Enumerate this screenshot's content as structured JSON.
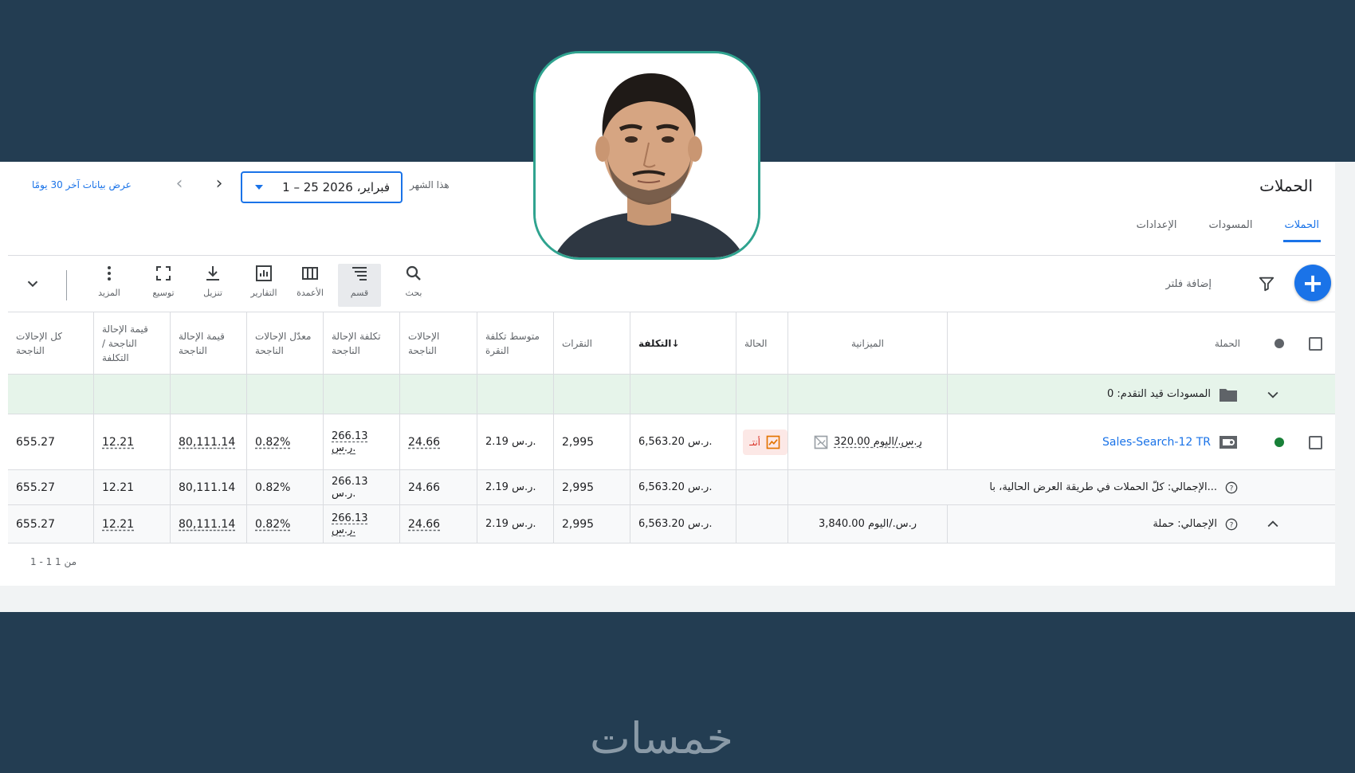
{
  "header": {
    "page_title": "الحملات",
    "date_range_link": "عرض بيانات آخر 30 يومًا",
    "date_range": "1 – 25 فبراير، 2026",
    "date_preset": "هذا الشهر"
  },
  "tabs": [
    {
      "label": "الحملات",
      "active": true
    },
    {
      "label": "المسودات",
      "active": false
    },
    {
      "label": "الإعدادات",
      "active": false
    }
  ],
  "toolbar": {
    "add_filter": "إضافة فلتر",
    "tools": [
      {
        "label": "بحث",
        "icon": "search-icon"
      },
      {
        "label": "قسم",
        "icon": "segment-icon"
      },
      {
        "label": "الأعمدة",
        "icon": "columns-icon"
      },
      {
        "label": "التقارير",
        "icon": "reports-icon"
      },
      {
        "label": "تنزيل",
        "icon": "download-icon"
      },
      {
        "label": "توسيع",
        "icon": "expand-icon"
      },
      {
        "label": "المزيد",
        "icon": "more-icon"
      }
    ]
  },
  "table": {
    "headers": {
      "campaign": "الحملة",
      "budget": "الميزانية",
      "status": "الحالة",
      "cost": "التكلفة",
      "clicks": "النقرات",
      "avg_cpc": "متوسط تكلفة النقرة",
      "conversions": "الإحالات الناجحة",
      "cost_per_conv": "تكلفة الإحالة الناجحة",
      "conv_rate": "معدّل الإحالات الناجحة",
      "conv_value": "قيمة الإحالة الناجحة",
      "value_per_cost": "قيمة الإحالة الناجحة / التكلفة",
      "all_conv": "كل الإحالات الناجحة"
    },
    "drafts_row": "المسودات قيد التقدم: 0",
    "campaign_row": {
      "name": "Sales-Search-12 TR",
      "budget": "320.00 ر.س./اليوم",
      "status": "أنتـ",
      "cost": "6,563.20 ر.س.",
      "clicks": "2,995",
      "avg_cpc": "2.19 ر.س.",
      "conversions": "24.66",
      "cost_per_conv": "266.13 ر.س.",
      "conv_rate": "0.82%",
      "conv_value": "80,111.14",
      "value_per_cost": "12.21",
      "all_conv": "655.27"
    },
    "total_all": {
      "label": "الإجمالي: كلّ الحملات في طريقة العرض الحالية، با...",
      "cost": "6,563.20 ر.س.",
      "clicks": "2,995",
      "avg_cpc": "2.19 ر.س.",
      "conversions": "24.66",
      "cost_per_conv": "266.13 ر.س.",
      "conv_rate": "0.82%",
      "conv_value": "80,111.14",
      "value_per_cost": "12.21",
      "all_conv": "655.27"
    },
    "total_campaign": {
      "label": "الإجمالي: حملة",
      "budget": "3,840.00 ر.س./اليوم",
      "cost": "6,563.20 ر.س.",
      "clicks": "2,995",
      "avg_cpc": "2.19 ر.س.",
      "conversions": "24.66",
      "cost_per_conv": "266.13 ر.س.",
      "conv_rate": "0.82%",
      "conv_value": "80,111.14",
      "value_per_cost": "12.21",
      "all_conv": "655.27"
    }
  },
  "pagination": "1 - 1 من 1",
  "brand": "خمسات",
  "colors": {
    "background": "#233d52",
    "accent": "#1a73e8",
    "avatar_border": "#2fa38f",
    "enabled_dot": "#188038",
    "drafts_row": "#e6f4ea"
  }
}
